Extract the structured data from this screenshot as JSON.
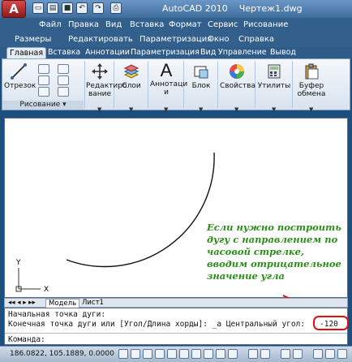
{
  "app": {
    "logo_letter": "A",
    "title": "AutoCAD 2010",
    "document": "Чертеж1.dwg"
  },
  "quick_access": [
    "new-icon",
    "open-icon",
    "save-icon",
    "undo-icon",
    "redo-icon",
    "print-icon"
  ],
  "menu": {
    "row1": [
      "Файл",
      "Правка",
      "Вид",
      "Вставка",
      "Формат",
      "Сервис",
      "Рисование"
    ],
    "row2": [
      "Размеры",
      "Редактировать",
      "Параметризация",
      "Окно",
      "Справка"
    ]
  },
  "ribbon_tabs": [
    "Главная",
    "Вставка",
    "Аннотации",
    "Параметризация",
    "Вид",
    "Управление",
    "Вывод"
  ],
  "ribbon": {
    "line_label": "Отрезок",
    "draw_panel_label": "Рисование",
    "modify_label": "Редактиро вание",
    "layers_label": "Слои",
    "annotations_label": "Аннотаци и",
    "block_label": "Блок",
    "properties_label": "Свойства",
    "utilities_label": "Утилиты",
    "clipboard_label": "Буфер обмена"
  },
  "model_tabs": [
    "Модель",
    "Лист1"
  ],
  "command_line": {
    "line1": "Начальная точка дуги:",
    "line2": "Конечная точка дуги или [Угол/Длина хорды]: _a Центральный угол:",
    "angle_value": "-120",
    "prompt": "Команда:"
  },
  "status": {
    "coordinates": "186.0822, 105.1889, 0.0000"
  },
  "annotation": {
    "text": "Если нужно построить дугу с направлением по часовой стрелке, вводим отрицательное значение угла",
    "color": "#2a8f18"
  },
  "ucs": {
    "x_label": "X",
    "y_label": "Y"
  },
  "colors": {
    "frame": "#1d4f7e",
    "highlight": "#e01010"
  }
}
